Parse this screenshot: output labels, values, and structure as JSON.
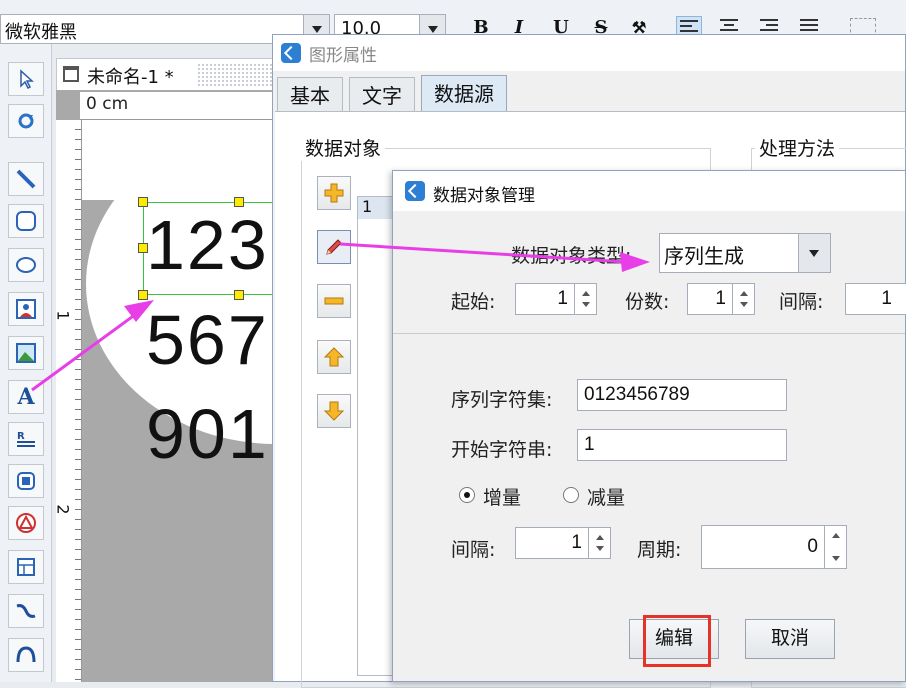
{
  "toolbar": {
    "font_family_value": "微软雅黑",
    "font_size_value": "10.0",
    "bold_label": "B",
    "italic_label": "I",
    "underline_label": "U",
    "strike_label": "S"
  },
  "document": {
    "tab_title": "未命名-1 *",
    "ruler_unit": "0 cm",
    "ruler_marks": [
      "1",
      "2"
    ],
    "sample_lines": [
      "123",
      "567",
      "901"
    ]
  },
  "graphic_properties_dialog": {
    "title": "图形属性",
    "tabs": [
      "基本",
      "文字",
      "数据源"
    ],
    "active_tab": "数据源",
    "data_object_group": "数据对象",
    "processing_group": "处理方法",
    "list_first_row": "1"
  },
  "data_object_dialog": {
    "title": "数据对象管理",
    "type_label": "数据对象类型:",
    "type_value": "序列生成",
    "start_label": "起始:",
    "start_value": "1",
    "copies_label": "份数:",
    "copies_value": "1",
    "interval_top_label": "间隔:",
    "interval_top_value": "1",
    "charset_label": "序列字符集:",
    "charset_value": "0123456789",
    "start_string_label": "开始字符串:",
    "start_string_value": "1",
    "increase_label": "增量",
    "decrease_label": "减量",
    "selected_mode": "增量",
    "interval_label": "间隔:",
    "interval_value": "1",
    "period_label": "周期:",
    "period_value": "0",
    "edit_button": "编辑",
    "cancel_button": "取消"
  },
  "colors": {
    "annotation_arrow": "#e83ee8",
    "highlight_box": "#e5332a",
    "selection_border": "#3cc43c",
    "handle_fill": "#ffeb00"
  },
  "icons": [
    "pointer-icon",
    "rotate-icon",
    "line-icon",
    "rounded-rect-icon",
    "ellipse-icon",
    "image-icon",
    "picture-icon",
    "text-icon",
    "barcode-icon",
    "shape-icon",
    "triangle-icon",
    "table-icon",
    "curve-icon",
    "arc-icon",
    "add-icon",
    "edit-pencil-icon",
    "remove-icon",
    "move-up-icon",
    "move-down-icon"
  ]
}
